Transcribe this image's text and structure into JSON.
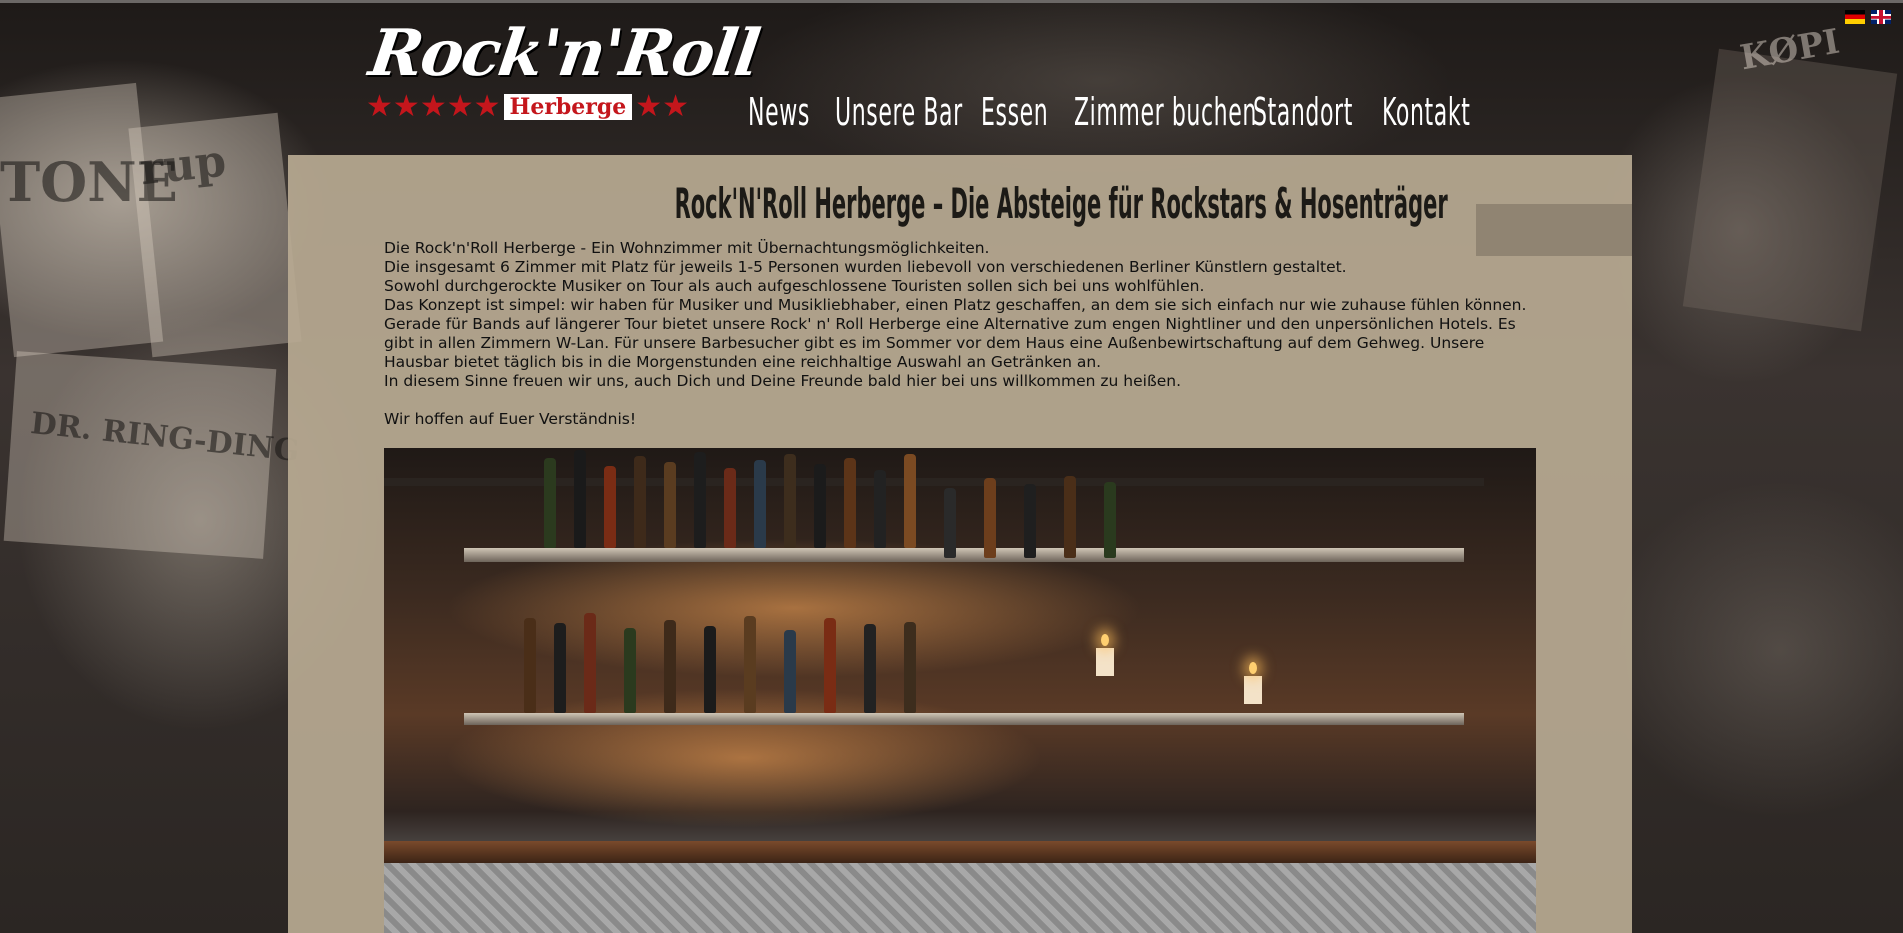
{
  "logo": {
    "script": "Rock'n'Roll",
    "subtitle": "Herberge"
  },
  "languages": [
    {
      "name": "Deutsch"
    },
    {
      "name": "English"
    }
  ],
  "nav": {
    "items": [
      "News",
      "Unsere Bar",
      "Essen",
      "Zimmer buchen",
      "Standort",
      "Kontakt"
    ]
  },
  "main": {
    "title": "Rock'N'Roll Herberge – Die Absteige für Rockstars & Hosenträger",
    "paragraphs": [
      "Die Rock'n'Roll Herberge - Ein Wohnzimmer mit Übernachtungsmöglichkeiten.",
      "Die insgesamt 6 Zimmer mit Platz für jeweils 1-5 Personen wurden liebevoll von verschiedenen Berliner Künstlern gestaltet.",
      "Sowohl durchgerockte Musiker on Tour als auch aufgeschlossene Touristen sollen sich bei uns wohlfühlen.",
      "Das Konzept ist simpel: wir haben für Musiker und Musikliebhaber, einen Platz geschaffen, an dem sie sich einfach nur wie zuhause fühlen können. Gerade für Bands auf längerer Tour bietet unsere Rock' n' Roll Herberge eine Alternative zum engen Nightliner und den unpersönlichen Hotels. Es gibt in allen Zimmern W-Lan. Für unsere Barbesucher gibt es im Sommer vor dem Haus eine Außenbewirtschaftung auf dem Gehweg. Unsere Hausbar bietet täglich bis in die Morgenstunden eine reichhaltige Auswahl an Getränken an.",
      "In diesem Sinne freuen wir uns, auch Dich und Deine Freunde bald hier bei uns willkommen zu heißen."
    ],
    "closing": "Wir hoffen auf Euer Verständnis!"
  },
  "colors": {
    "panel": "#b8aa92",
    "logo_red": "#c4161c",
    "nav_text": "#ffffff"
  }
}
